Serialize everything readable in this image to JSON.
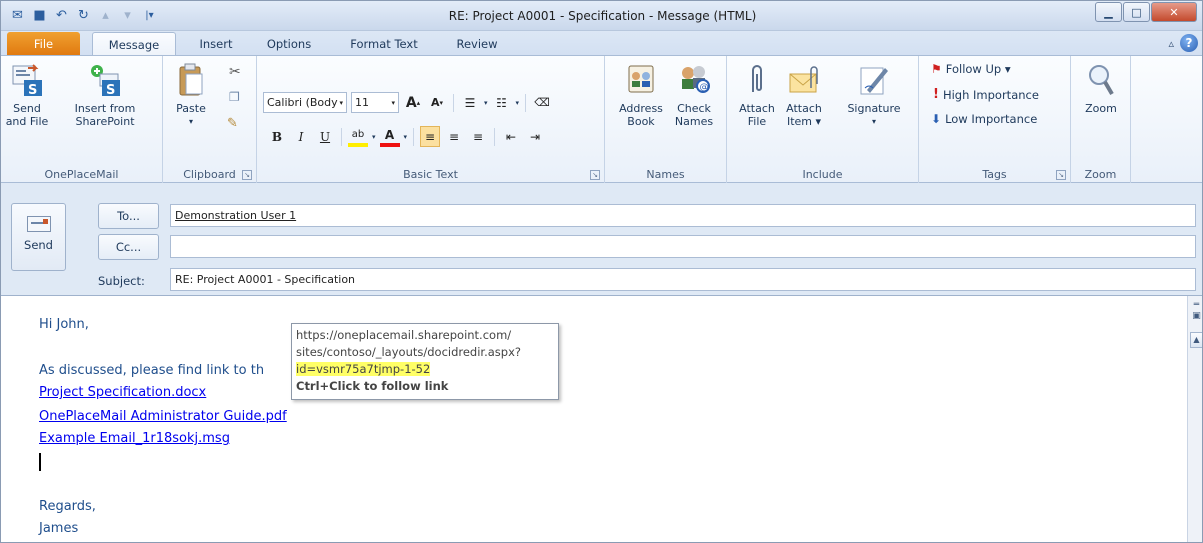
{
  "window": {
    "title": "RE: Project A0001 - Specification  -  Message (HTML)"
  },
  "tabs": [
    "File",
    "Message",
    "Insert",
    "Options",
    "Format Text",
    "Review"
  ],
  "ribbon": {
    "oneplacemail": {
      "label": "OnePlaceMail",
      "send_and_file": [
        "Send",
        "and File"
      ],
      "insert_from": [
        "Insert from",
        "SharePoint"
      ]
    },
    "clipboard": {
      "label": "Clipboard",
      "paste": "Paste"
    },
    "basic_text": {
      "label": "Basic Text",
      "font": "Calibri (Body",
      "size": "11"
    },
    "names": {
      "label": "Names",
      "address_book": [
        "Address",
        "Book"
      ],
      "check_names": [
        "Check",
        "Names"
      ]
    },
    "include": {
      "label": "Include",
      "attach_file": [
        "Attach",
        "File"
      ],
      "attach_item": [
        "Attach",
        "Item ▾"
      ],
      "signature": "Signature"
    },
    "tags": {
      "label": "Tags",
      "follow_up": "Follow Up ▾",
      "high": "High Importance",
      "low": "Low Importance"
    },
    "zoom": {
      "label": "Zoom",
      "zoom": "Zoom"
    }
  },
  "compose": {
    "send": "Send",
    "to_button": "To...",
    "cc_button": "Cc...",
    "subject_label": "Subject:",
    "to_value": "Demonstration User 1",
    "cc_value": "",
    "subject_value": "RE: Project A0001 - Specification"
  },
  "body": {
    "greeting": "Hi John,",
    "intro": "As discussed, please find link to th",
    "links": [
      "Project Specification.docx",
      "OnePlaceMail Administrator Guide.pdf",
      "Example Email_1r18sokj.msg"
    ],
    "regards": "Regards,",
    "name": "James"
  },
  "tooltip": {
    "line1": "https://oneplacemail.sharepoint.com/",
    "line2": "sites/contoso/_layouts/docidredir.aspx?",
    "line3": "id=vsmr75a7tjmp-1-52",
    "line4": "Ctrl+Click to follow link"
  },
  "colors": {
    "file_tab": "#e07a10",
    "link": "#0000ee",
    "body_text": "#1f4e8c",
    "highlight": "#ffff66"
  }
}
